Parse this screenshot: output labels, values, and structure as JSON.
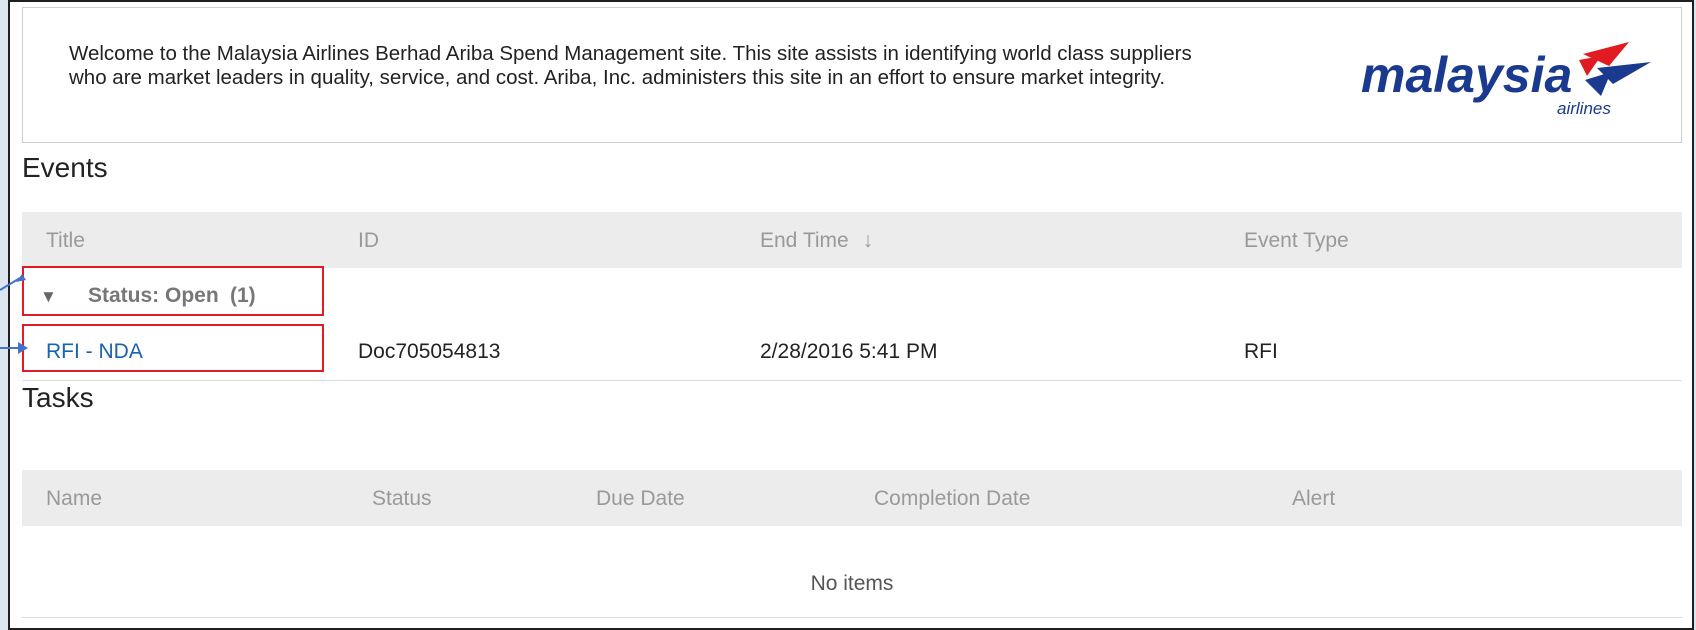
{
  "welcome": {
    "line1": "Welcome to the Malaysia Airlines Berhad Ariba Spend Management site. This site assists in identifying world class suppliers",
    "line2": "who are market leaders in quality, service, and cost. Ariba, Inc. administers this site in an effort to ensure market integrity."
  },
  "logo": {
    "word": "malaysia",
    "sub": "airlines",
    "brand_color": "#1a3a8f",
    "accent_color": "#e01b22"
  },
  "events": {
    "title": "Events",
    "columns": {
      "title": "Title",
      "id": "ID",
      "end_time": "End Time",
      "sort_icon": "↓",
      "event_type": "Event Type"
    },
    "group": {
      "caret": "▼",
      "label": "Status: Open",
      "count": "(1)"
    },
    "rows": [
      {
        "title": "RFI - NDA",
        "id": "Doc705054813",
        "end_time": "2/28/2016 5:41 PM",
        "event_type": "RFI"
      }
    ]
  },
  "tasks": {
    "title": "Tasks",
    "columns": {
      "name": "Name",
      "status": "Status",
      "due_date": "Due Date",
      "completion_date": "Completion Date",
      "alert": "Alert"
    },
    "empty_text": "No items"
  },
  "colors": {
    "link": "#1a63ad",
    "highlight": "#e11c24",
    "header_bg": "#ececec",
    "annotation": "#4472c4"
  }
}
